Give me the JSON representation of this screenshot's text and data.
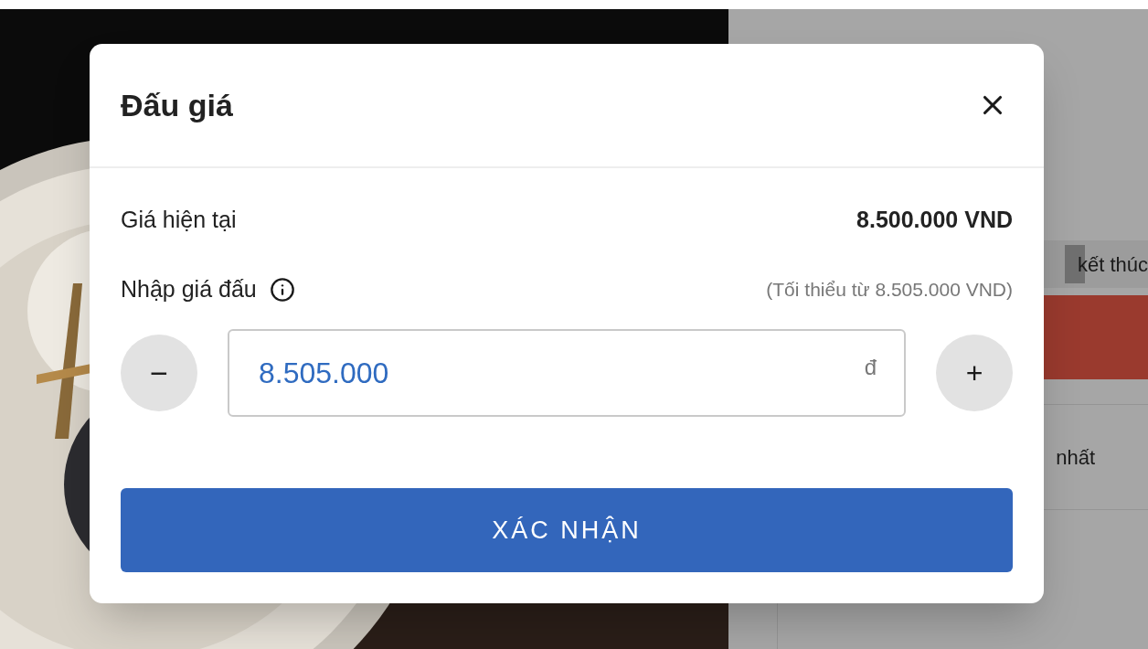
{
  "background": {
    "side_panel": {
      "status_fragment": "kết thúc",
      "rank_fragment": "nhất"
    }
  },
  "dialog": {
    "title": "Đấu giá",
    "current_price": {
      "label": "Giá hiện tại",
      "value": "8.500.000 VND"
    },
    "bid": {
      "label": "Nhập giá đấu",
      "hint": "(Tối thiểu từ 8.505.000 VND)",
      "value": "8.505.000",
      "currency": "đ",
      "decrement": "−",
      "increment": "+"
    },
    "confirm_button": "XÁC NHẬN"
  }
}
